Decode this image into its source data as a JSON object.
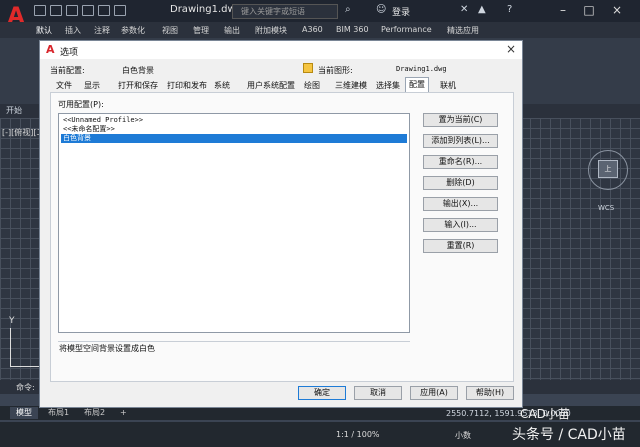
{
  "app": {
    "logo_letter": "A",
    "document_title": "Drawing1.dwg",
    "search_placeholder": "键入关键字或短语",
    "login_label": "登录",
    "ribbon_tabs": [
      "默认",
      "插入",
      "注释",
      "参数化",
      "视图",
      "管理",
      "输出",
      "附加模块",
      "A360",
      "BIM 360",
      "Performance",
      "精选应用"
    ],
    "file_tab": "开始",
    "viewport_label": "[-][俯视][二",
    "viewcube_face": "上",
    "wcs_label": "WCS",
    "ucs_y": "Y",
    "command_label": "命令:",
    "layout_tabs": [
      "模型",
      "布局1",
      "布局2"
    ],
    "add_layout": "+",
    "coordinates": "2550.7112, 1591.9513, 0.0000",
    "status_scale": "1:1 / 100%",
    "status_decimal": "小数",
    "watermark_line1": "CAD小苗",
    "watermark_line2": "头条号 / CAD小苗"
  },
  "dialog": {
    "title": "选项",
    "close_glyph": "×",
    "current_profile_label": "当前配置:",
    "current_profile_value": "白色背景",
    "current_drawing_label": "当前图形:",
    "current_drawing_value": "Drawing1.dwg",
    "tabs": [
      "文件",
      "显示",
      "打开和保存",
      "打印和发布",
      "系统",
      "用户系统配置",
      "绘图",
      "三维建模",
      "选择集",
      "配置",
      "联机"
    ],
    "active_tab": "配置",
    "available_profiles_label": "可用配置(P):",
    "profiles": [
      "<<Unnamed Profile>>",
      "<<未命名配置>>",
      "白色背景"
    ],
    "selected_profile_index": 2,
    "side_buttons": [
      "置为当前(C)",
      "添加到列表(L)...",
      "重命名(R)...",
      "删除(D)",
      "输出(X)...",
      "输入(I)...",
      "重置(R)"
    ],
    "description": "将模型空间背景设置成白色",
    "footer_buttons": {
      "ok": "确定",
      "cancel": "取消",
      "apply": "应用(A)",
      "help": "帮助(H)"
    }
  },
  "colors": {
    "accent": "#1e7bd6",
    "logo_red": "#e02a2a",
    "canvas_bg": "#2f3642"
  }
}
